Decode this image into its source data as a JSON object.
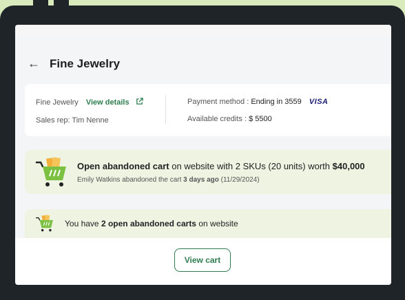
{
  "header": {
    "back_icon": "arrow-left-icon",
    "title": "Fine Jewelry"
  },
  "account": {
    "name": "Fine Jewelry",
    "view_details": "View details",
    "sales_rep": "Sales rep: Tim Nenne",
    "payment_label": "Payment method :",
    "payment_value": "Ending in 3559",
    "card_brand": "VISA",
    "credits_label": "Available credits :",
    "credits_value": "$ 5500"
  },
  "abandoned_cart": {
    "bold_prefix": "Open abandoned cart",
    "middle": " on website with 2 SKUs (20 units) worth ",
    "amount": "$40,000",
    "sub_prefix": "Emily Watkins abandoned the cart ",
    "sub_bold": "3 days ago",
    "sub_date": "(11/29/2024)"
  },
  "carts_summary": {
    "prefix": "You have ",
    "bold": "2 open abandoned carts",
    "suffix": " on website"
  },
  "footer": {
    "view_cart": "View cart"
  },
  "colors": {
    "accent": "#2e7d4f",
    "banner": "#eef3e2",
    "background": "#d9ebbd",
    "cart_green": "#7cc142"
  }
}
